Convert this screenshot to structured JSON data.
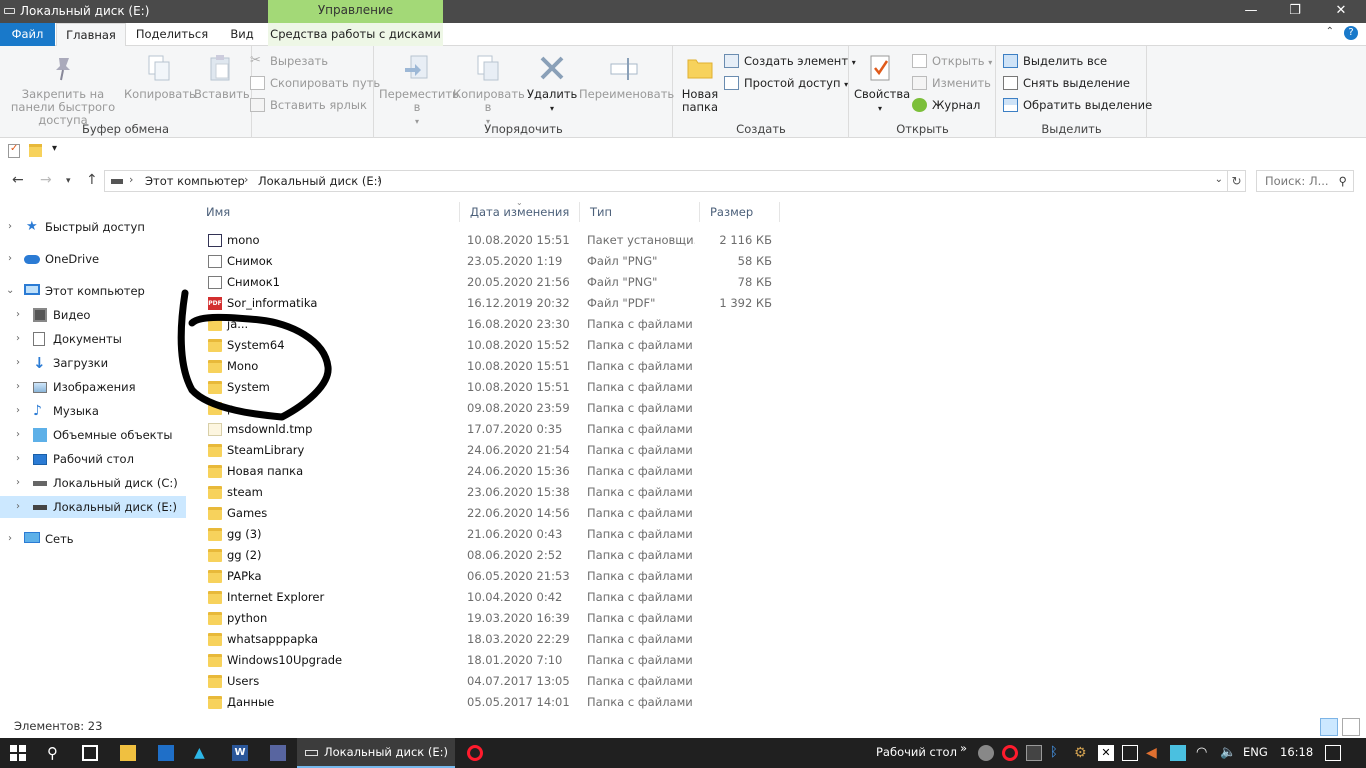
{
  "window": {
    "title": "Локальный диск (E:)",
    "context_tab_header": "Управление",
    "controls": [
      "—",
      "❐",
      "✕"
    ]
  },
  "ribbon_tabs": [
    "Файл",
    "Главная",
    "Поделиться",
    "Вид",
    "Средства работы с дисками"
  ],
  "ribbon": {
    "clipboard": {
      "label": "Буфер обмена",
      "pin": "Закрепить на панели быстрого доступа",
      "copy": "Копировать",
      "paste": "Вставить",
      "cut": "Вырезать",
      "copy_path": "Скопировать путь",
      "paste_shortcut": "Вставить ярлык"
    },
    "organize": {
      "label": "Упорядочить",
      "move": "Переместить в",
      "copy_to": "Копировать в",
      "delete": "Удалить",
      "rename": "Переименовать"
    },
    "create": {
      "label": "Создать",
      "new_folder": "Новая папка",
      "new_item": "Создать элемент",
      "easy_access": "Простой доступ"
    },
    "open": {
      "label": "Открыть",
      "properties": "Свойства",
      "open": "Открыть",
      "edit": "Изменить",
      "history": "Журнал"
    },
    "select": {
      "label": "Выделить",
      "select_all": "Выделить все",
      "select_none": "Снять выделение",
      "invert": "Обратить выделение"
    }
  },
  "address": {
    "crumbs": [
      "Этот компьютер",
      "Локальный диск (E:)"
    ],
    "search_placeholder": "Поиск: Л..."
  },
  "nav": [
    {
      "label": "Быстрый доступ",
      "icon": "star-icon"
    },
    {
      "label": "OneDrive",
      "icon": "cloud-icon"
    },
    {
      "label": "Этот компьютер",
      "icon": "computer-icon"
    },
    {
      "label": "Видео",
      "icon": "video-icon"
    },
    {
      "label": "Документы",
      "icon": "documents-icon"
    },
    {
      "label": "Загрузки",
      "icon": "downloads-icon"
    },
    {
      "label": "Изображения",
      "icon": "pictures-icon"
    },
    {
      "label": "Музыка",
      "icon": "music-icon"
    },
    {
      "label": "Объемные объекты",
      "icon": "3d-objects-icon"
    },
    {
      "label": "Рабочий стол",
      "icon": "desktop-icon"
    },
    {
      "label": "Локальный диск (C:)",
      "icon": "drive-icon"
    },
    {
      "label": "Локальный диск (E:)",
      "icon": "drive-icon"
    },
    {
      "label": "Сеть",
      "icon": "network-icon"
    }
  ],
  "columns": [
    "Имя",
    "Дата изменения",
    "Тип",
    "Размер"
  ],
  "files": [
    {
      "name": "mono",
      "date": "10.08.2020 15:51",
      "type": "Пакет установщи...",
      "size": "2 116 КБ",
      "icon": "pkg"
    },
    {
      "name": "Снимок",
      "date": "23.05.2020 1:19",
      "type": "Файл \"PNG\"",
      "size": "58 КБ",
      "icon": "file"
    },
    {
      "name": "Снимок1",
      "date": "20.05.2020 21:56",
      "type": "Файл \"PNG\"",
      "size": "78 КБ",
      "icon": "file"
    },
    {
      "name": "Sor_informatika",
      "date": "16.12.2019 20:32",
      "type": "Файл \"PDF\"",
      "size": "1 392 КБ",
      "icon": "pdf"
    },
    {
      "name": "ja...",
      "date": "16.08.2020 23:30",
      "type": "Папка с файлами",
      "size": "",
      "icon": "folder"
    },
    {
      "name": "System64",
      "date": "10.08.2020 15:52",
      "type": "Папка с файлами",
      "size": "",
      "icon": "folder"
    },
    {
      "name": "Mono",
      "date": "10.08.2020 15:51",
      "type": "Папка с файлами",
      "size": "",
      "icon": "folder"
    },
    {
      "name": "System",
      "date": "10.08.2020 15:51",
      "type": "Папка с файлами",
      "size": "",
      "icon": "folder"
    },
    {
      "name": "p...",
      "date": "09.08.2020 23:59",
      "type": "Папка с файлами",
      "size": "",
      "icon": "folder"
    },
    {
      "name": "msdownld.tmp",
      "date": "17.07.2020 0:35",
      "type": "Папка с файлами",
      "size": "",
      "icon": "tmp"
    },
    {
      "name": "SteamLibrary",
      "date": "24.06.2020 21:54",
      "type": "Папка с файлами",
      "size": "",
      "icon": "folder"
    },
    {
      "name": "Новая папка",
      "date": "24.06.2020 15:36",
      "type": "Папка с файлами",
      "size": "",
      "icon": "folder"
    },
    {
      "name": "steam",
      "date": "23.06.2020 15:38",
      "type": "Папка с файлами",
      "size": "",
      "icon": "folder"
    },
    {
      "name": "Games",
      "date": "22.06.2020 14:56",
      "type": "Папка с файлами",
      "size": "",
      "icon": "folder"
    },
    {
      "name": "gg (3)",
      "date": "21.06.2020 0:43",
      "type": "Папка с файлами",
      "size": "",
      "icon": "folder"
    },
    {
      "name": "gg (2)",
      "date": "08.06.2020 2:52",
      "type": "Папка с файлами",
      "size": "",
      "icon": "folder"
    },
    {
      "name": "PAPka",
      "date": "06.05.2020 21:53",
      "type": "Папка с файлами",
      "size": "",
      "icon": "folder"
    },
    {
      "name": "Internet Explorer",
      "date": "10.04.2020 0:42",
      "type": "Папка с файлами",
      "size": "",
      "icon": "folder"
    },
    {
      "name": "python",
      "date": "19.03.2020 16:39",
      "type": "Папка с файлами",
      "size": "",
      "icon": "folder"
    },
    {
      "name": "whatsapppapka",
      "date": "18.03.2020 22:29",
      "type": "Папка с файлами",
      "size": "",
      "icon": "folder"
    },
    {
      "name": "Windows10Upgrade",
      "date": "18.01.2020 7:10",
      "type": "Папка с файлами",
      "size": "",
      "icon": "folder"
    },
    {
      "name": "Users",
      "date": "04.07.2017 13:05",
      "type": "Папка с файлами",
      "size": "",
      "icon": "folder"
    },
    {
      "name": "Данные",
      "date": "05.05.2017 14:01",
      "type": "Папка с файлами",
      "size": "",
      "icon": "folder"
    }
  ],
  "status": {
    "count": "Элементов: 23"
  },
  "taskbar": {
    "app_label": "Локальный диск (E:)",
    "desktop": "Рабочий стол",
    "lang": "ENG",
    "time": "16:18"
  },
  "colors": {
    "accent": "#1979ca",
    "context_tab": "#a3d977",
    "selection": "#cce8ff"
  }
}
